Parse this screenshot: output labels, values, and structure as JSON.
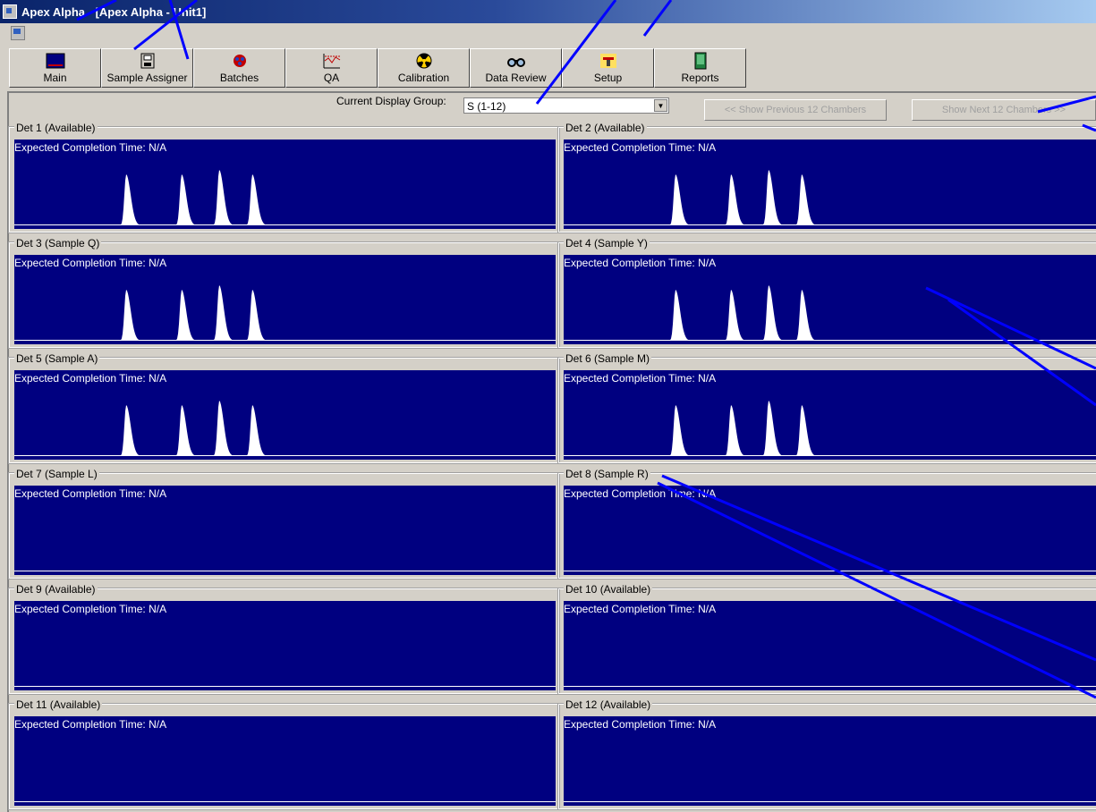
{
  "window": {
    "title": "Apex Alpha - [Apex Alpha - Unit1]"
  },
  "toolbar": {
    "buttons": [
      {
        "label": "Main",
        "icon": "main-icon"
      },
      {
        "label": "Sample Assigner",
        "icon": "sample-assigner-icon"
      },
      {
        "label": "Batches",
        "icon": "batches-icon"
      },
      {
        "label": "QA",
        "icon": "qa-icon"
      },
      {
        "label": "Calibration",
        "icon": "calibration-icon"
      },
      {
        "label": "Data Review",
        "icon": "data-review-icon"
      },
      {
        "label": "Setup",
        "icon": "setup-icon"
      },
      {
        "label": "Reports",
        "icon": "reports-icon"
      }
    ]
  },
  "display_group": {
    "label": "Current Display Group:",
    "value": "S (1-12)"
  },
  "nav": {
    "prev": "<< Show Previous 12 Chambers",
    "next": "Show Next 12 Chambers >>"
  },
  "detectors": [
    {
      "label": "Det 1 (Available)",
      "completion": "Expected Completion Time: N/A",
      "has_spectrum": true
    },
    {
      "label": "Det 2 (Available)",
      "completion": "Expected Completion Time: N/A",
      "has_spectrum": true
    },
    {
      "label": "Det 3 (Sample Q)",
      "completion": "Expected Completion Time: N/A",
      "has_spectrum": true
    },
    {
      "label": "Det 4 (Sample Y)",
      "completion": "Expected Completion Time: N/A",
      "has_spectrum": true
    },
    {
      "label": "Det 5 (Sample A)",
      "completion": "Expected Completion Time: N/A",
      "has_spectrum": true
    },
    {
      "label": "Det 6 (Sample M)",
      "completion": "Expected Completion Time: N/A",
      "has_spectrum": true
    },
    {
      "label": "Det 7 (Sample L)",
      "completion": "Expected Completion Time: N/A",
      "has_spectrum": false
    },
    {
      "label": "Det 8 (Sample R)",
      "completion": "Expected Completion Time: N/A",
      "has_spectrum": false
    },
    {
      "label": "Det 9 (Available)",
      "completion": "Expected Completion Time: N/A",
      "has_spectrum": false
    },
    {
      "label": "Det 10 (Available)",
      "completion": "Expected Completion Time: N/A",
      "has_spectrum": false
    },
    {
      "label": "Det 11 (Available)",
      "completion": "Expected Completion Time: N/A",
      "has_spectrum": false
    },
    {
      "label": "Det 12 (Available)",
      "completion": "Expected Completion Time: N/A",
      "has_spectrum": false
    }
  ],
  "colors": {
    "plot_bg": "#000080",
    "annotation_line": "#0000ff",
    "titlebar": "#0a246a"
  }
}
